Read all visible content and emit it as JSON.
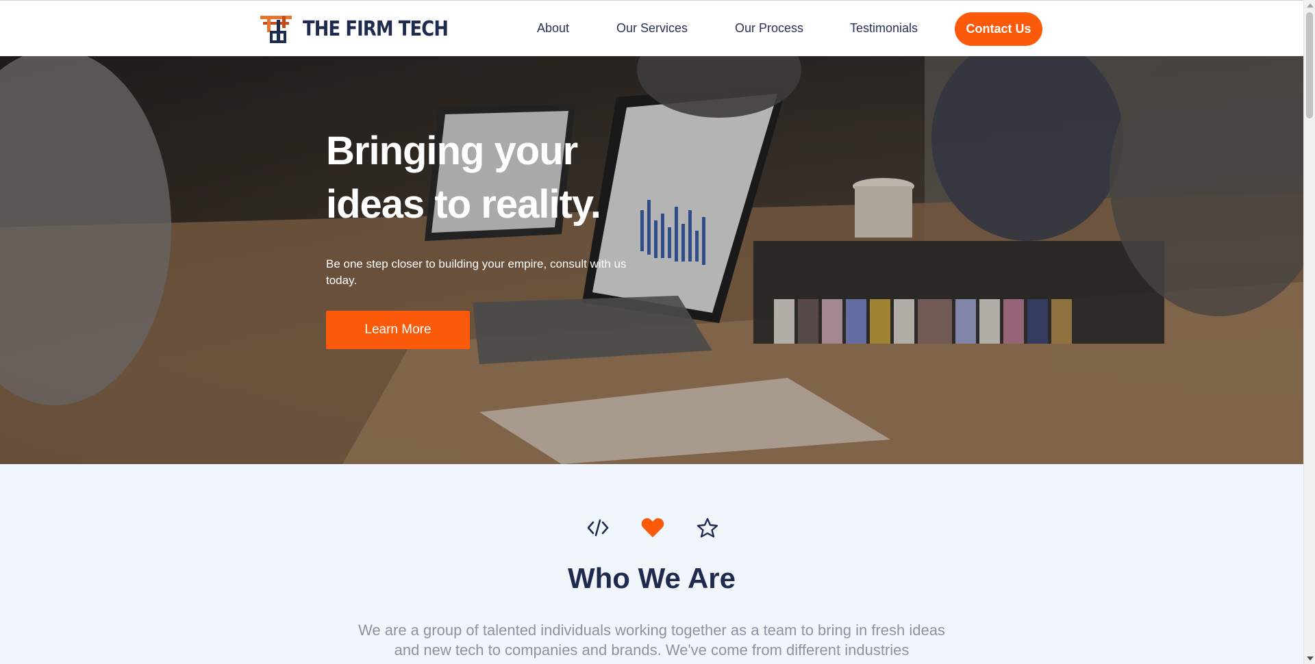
{
  "header": {
    "brand_name": "THE FIRM TECH",
    "nav": [
      {
        "label": "About"
      },
      {
        "label": "Our Services"
      },
      {
        "label": "Our Process"
      },
      {
        "label": "Testimonials"
      }
    ],
    "contact_label": "Contact Us"
  },
  "hero": {
    "title_line1": "Bringing your",
    "title_line2": "ideas to reality.",
    "subtitle": "Be one step closer to building your empire, consult with us today.",
    "cta_label": "Learn More"
  },
  "who": {
    "icons": [
      "code-icon",
      "heart-icon",
      "star-icon"
    ],
    "title": "Who We Are",
    "text": "We are a group of talented individuals working together as a team to bring in fresh ideas and new tech to companies and brands. We've come from different industries"
  },
  "colors": {
    "accent": "#fa5a0a",
    "navy": "#1f2b4e",
    "section_bg": "#f1f5fc"
  }
}
